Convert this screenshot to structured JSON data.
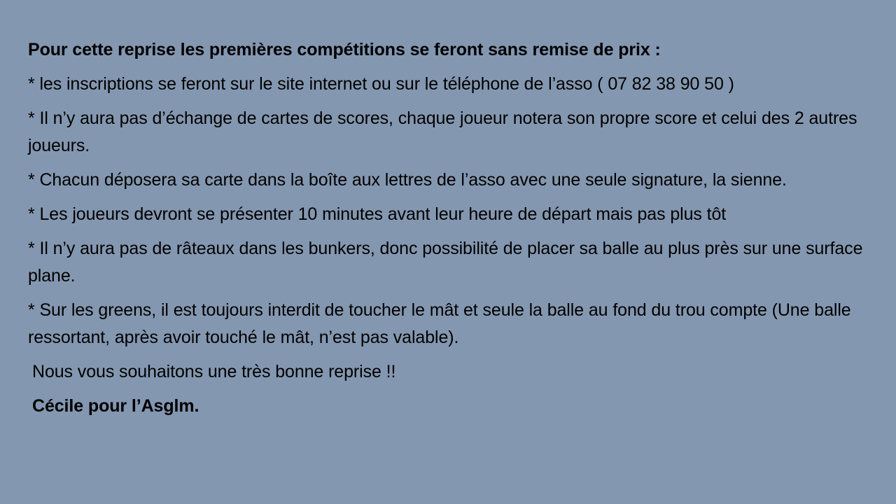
{
  "slide": {
    "heading": "Pour cette reprise les premières compétitions se feront sans remise de prix :",
    "items": [
      "* les inscriptions se feront sur le site internet ou sur le téléphone de l’asso ( 07 82 38 90 50 )",
      "* Il n’y aura pas d’échange de cartes de scores, chaque joueur notera son propre score et celui des 2 autres joueurs.",
      "* Chacun déposera sa carte dans la boîte aux lettres de l’asso avec une seule signature, la sienne.",
      "* Les joueurs devront se présenter 10 minutes avant leur heure de départ mais pas plus tôt",
      "* Il n’y aura pas de râteaux dans les bunkers, donc possibilité de placer sa balle au plus près sur une surface plane.",
      "* Sur les greens, il est toujours interdit de toucher le mât et seule la balle au fond du trou compte (Une balle ressortant, après avoir touché le mât, n’est pas valable)."
    ],
    "closing": "Nous vous souhaitons une très bonne reprise !!",
    "signature": "Cécile pour l’Asglm."
  },
  "colors": {
    "background": "#8497b0",
    "text": "#000000"
  }
}
